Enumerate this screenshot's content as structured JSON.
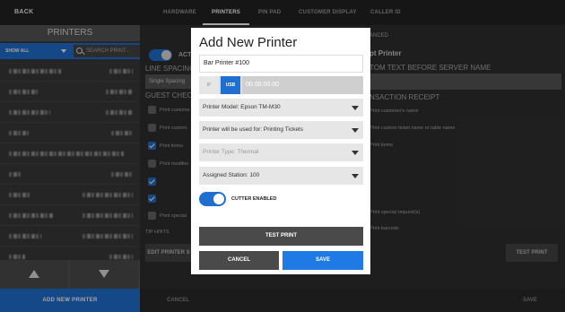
{
  "topbar": {
    "back_label": "BACK",
    "tabs": [
      {
        "label": "HARDWARE",
        "active": false
      },
      {
        "label": "PRINTERS",
        "active": true
      },
      {
        "label": "PIN PAD",
        "active": false
      },
      {
        "label": "CUSTOMER DISPLAY",
        "active": false
      },
      {
        "label": "CALLER ID",
        "active": false
      }
    ]
  },
  "sidebar": {
    "title": "PRINTERS",
    "filter_label": "SHOW ALL",
    "search_placeholder": "SEARCH PRINT...",
    "add_button_label": "ADD NEW PRINTER"
  },
  "background": {
    "active_label": "ACT",
    "line_spacing_label": "LINE SPACING",
    "line_spacing_value": "Single Spacing",
    "guest_check_label": "GUEST CHECK",
    "guest_items": [
      "Print custome",
      "Print custom",
      "Print items",
      "Print modifier",
      "",
      "",
      "Print special"
    ],
    "guest_checked": [
      false,
      false,
      true,
      false,
      true,
      true,
      false
    ],
    "tip_hints_label": "TIP HINTS",
    "edit_printer_label": "EDIT PRINTER S",
    "cancel_label": "CANCEL",
    "advanced_label": "ANCED",
    "receipt_title": "pt Printer",
    "custom_text_label": "TOM TEXT BEFORE SERVER NAME",
    "transaction_label": "NSACTION RECEIPT",
    "receipt_items": [
      "Print customer's name",
      "Print custom ticket name or table name",
      "Print items",
      "",
      "",
      "",
      "Print special request(s)",
      "Print barcode"
    ],
    "test_print_label": "TEST PRINT",
    "save_label": "SAVE"
  },
  "modal": {
    "title": "Add New Printer",
    "printer_name": "Bar Printer #100",
    "ip_label": "IP",
    "usb_label": "USB",
    "address": "00.00.00.00",
    "model": "Printer Model: Epson TM-M30",
    "usage": "Printer will be used for: Printing Tickets",
    "type": "Printer Type: Thermal",
    "station": "Assigned Station: 100",
    "cutter_label": "CUTTER ENABLED",
    "cutter_enabled": true,
    "test_print_label": "TEST PRINT",
    "cancel_label": "CANCEL",
    "save_label": "SAVE"
  },
  "colors": {
    "accent": "#1f6fd0",
    "save": "#1f7ae6",
    "dark_button": "#4a4a4a"
  }
}
